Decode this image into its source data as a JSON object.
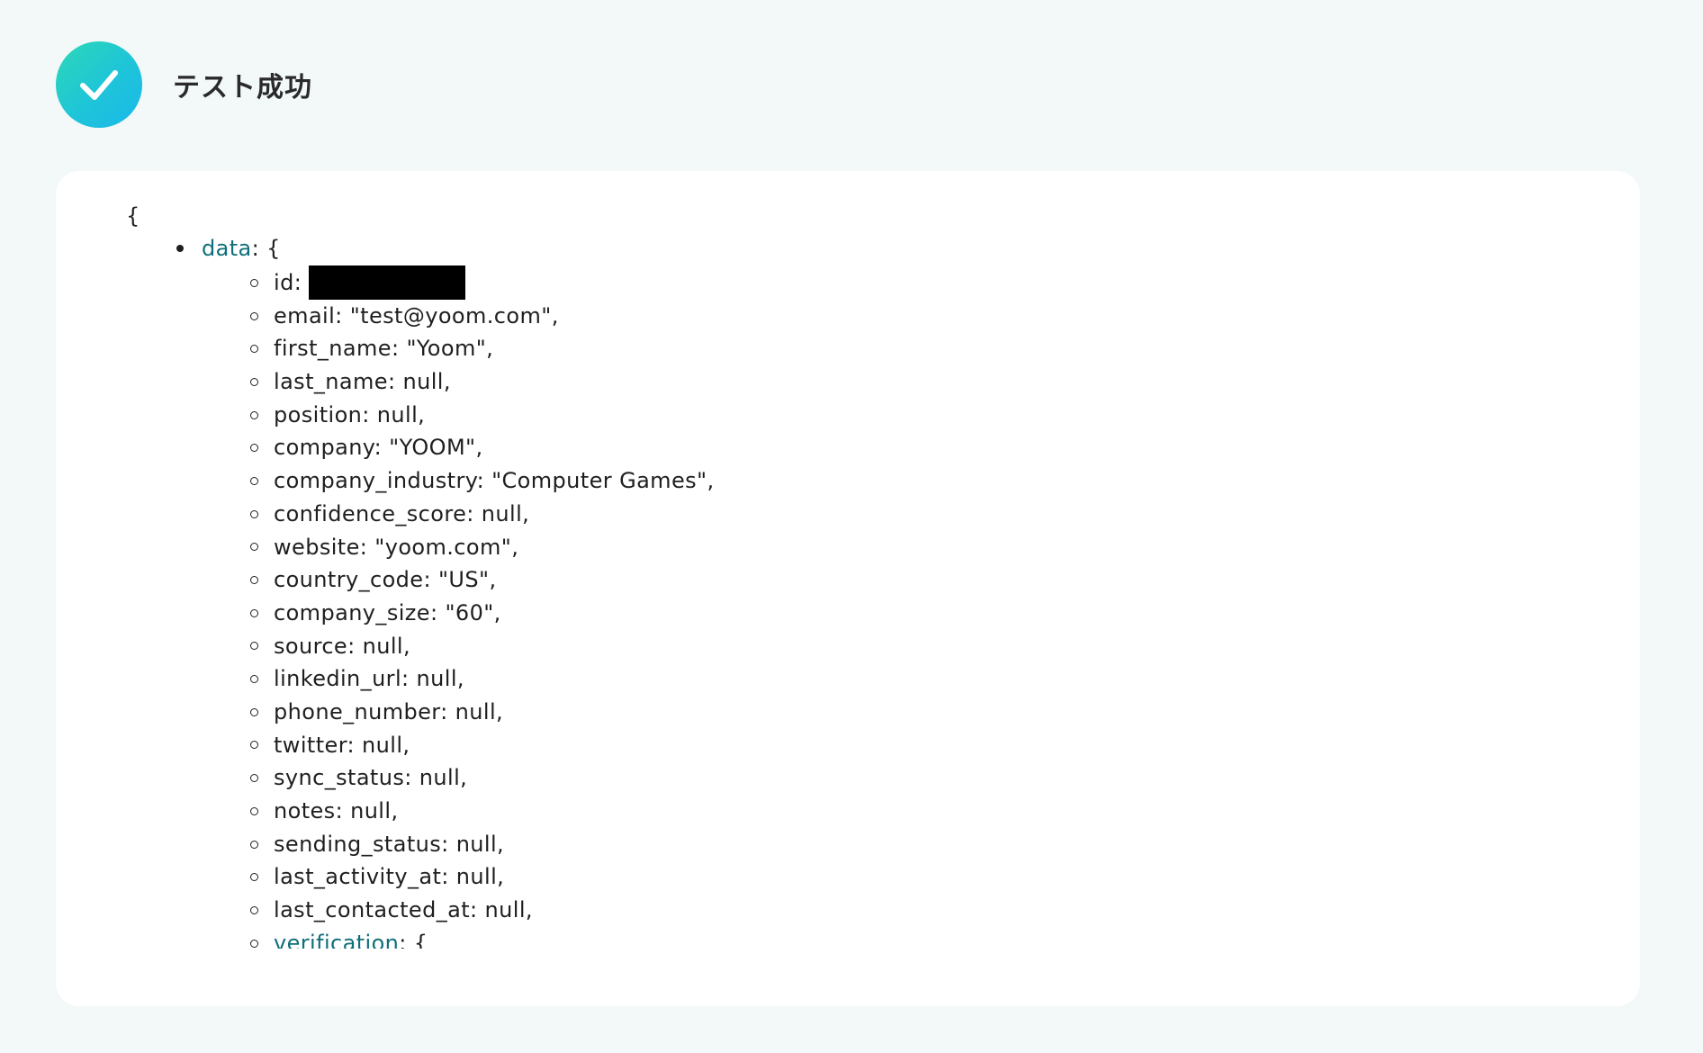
{
  "header": {
    "title": "テスト成功",
    "icon": "check-icon",
    "icon_gradient": [
      "#2ed8b6",
      "#1ab8ea"
    ]
  },
  "code": {
    "open_brace": "{",
    "data_key": "data",
    "data_suffix": ": {",
    "id_label": "id:",
    "fields": [
      "email: \"test@yoom.com\",",
      "first_name: \"Yoom\",",
      "last_name: null,",
      "position: null,",
      "company: \"YOOM\",",
      "company_industry: \"Computer Games\",",
      "confidence_score: null,",
      "website: \"yoom.com\",",
      "country_code: \"US\",",
      "company_size: \"60\",",
      "source: null,",
      "linkedin_url: null,",
      "phone_number: null,",
      "twitter: null,",
      "sync_status: null,",
      "notes: null,",
      "sending_status: null,",
      "last_activity_at: null,",
      "last_contacted_at: null,"
    ],
    "verification_key": "verification",
    "verification_suffix": ": {"
  },
  "colors": {
    "page_bg": "#f3f8f8",
    "panel_bg": "#ffffff",
    "key_link": "#0f6f7a",
    "text": "#1f1f1f"
  }
}
